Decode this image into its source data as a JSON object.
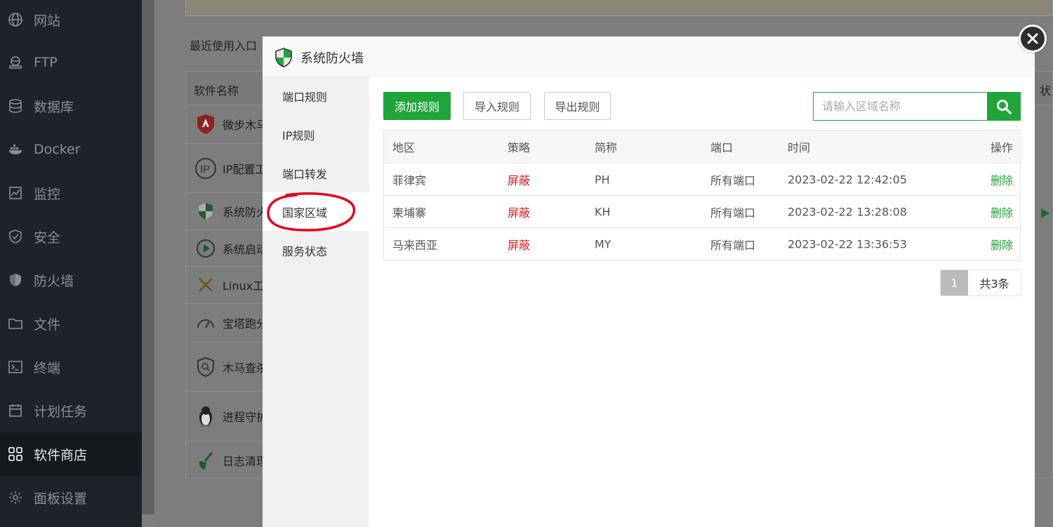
{
  "sidebar": {
    "items": [
      {
        "label": "网站",
        "icon": "globe-icon"
      },
      {
        "label": "FTP",
        "icon": "ftp-icon"
      },
      {
        "label": "数据库",
        "icon": "database-icon"
      },
      {
        "label": "Docker",
        "icon": "docker-icon"
      },
      {
        "label": "监控",
        "icon": "monitor-icon"
      },
      {
        "label": "安全",
        "icon": "shield-check-icon"
      },
      {
        "label": "防火墙",
        "icon": "firewall-icon"
      },
      {
        "label": "文件",
        "icon": "folder-icon"
      },
      {
        "label": "终端",
        "icon": "terminal-icon"
      },
      {
        "label": "计划任务",
        "icon": "calendar-icon"
      },
      {
        "label": "软件商店",
        "icon": "apps-grid-icon",
        "active": true
      },
      {
        "label": "面板设置",
        "icon": "gear-icon"
      }
    ]
  },
  "background_page": {
    "recent_label": "最近使用入口",
    "table_header_name": "软件名称",
    "table_header_status": "状",
    "plugins": [
      {
        "name": "微步木马",
        "icon": "threatbook-icon"
      },
      {
        "name": "IP配置工",
        "icon": "ip-icon"
      },
      {
        "name": "系统防火",
        "icon": "firewall-shield-icon"
      },
      {
        "name": "系统启动",
        "icon": "startup-play-icon"
      },
      {
        "name": "Linux工",
        "icon": "tools-icon"
      },
      {
        "name": "宝塔跑分",
        "icon": "speedometer-icon"
      },
      {
        "name": "木马查杀",
        "icon": "scan-shield-icon"
      },
      {
        "name": "进程守护",
        "icon": "linux-penguin-icon"
      },
      {
        "name": "日志清理",
        "icon": "broom-icon"
      }
    ]
  },
  "modal": {
    "title": "系统防火墙",
    "nav": [
      {
        "label": "端口规则"
      },
      {
        "label": "IP规则"
      },
      {
        "label": "端口转发"
      },
      {
        "label": "国家区域",
        "active": true
      },
      {
        "label": "服务状态"
      }
    ],
    "toolbar": {
      "add_label": "添加规则",
      "import_label": "导入规则",
      "export_label": "导出规则",
      "search_placeholder": "请输入区域名称"
    },
    "table": {
      "columns": [
        "地区",
        "策略",
        "简称",
        "端口",
        "时间",
        "操作"
      ],
      "rows": [
        {
          "region": "菲律宾",
          "policy": "屏蔽",
          "code": "PH",
          "port": "所有端口",
          "time": "2023-02-22 12:42:05",
          "action": "删除"
        },
        {
          "region": "柬埔寨",
          "policy": "屏蔽",
          "code": "KH",
          "port": "所有端口",
          "time": "2023-02-22 13:28:08",
          "action": "删除"
        },
        {
          "region": "马来西亚",
          "policy": "屏蔽",
          "code": "MY",
          "port": "所有端口",
          "time": "2023-02-22 13:36:53",
          "action": "删除"
        }
      ]
    },
    "pagination": {
      "current_page": "1",
      "total_label": "共3条"
    }
  },
  "colors": {
    "accent_green": "#20a53a",
    "danger_red": "#e01c1c",
    "sidebar_bg": "#1e2329",
    "annotation_red": "#e3001b"
  }
}
